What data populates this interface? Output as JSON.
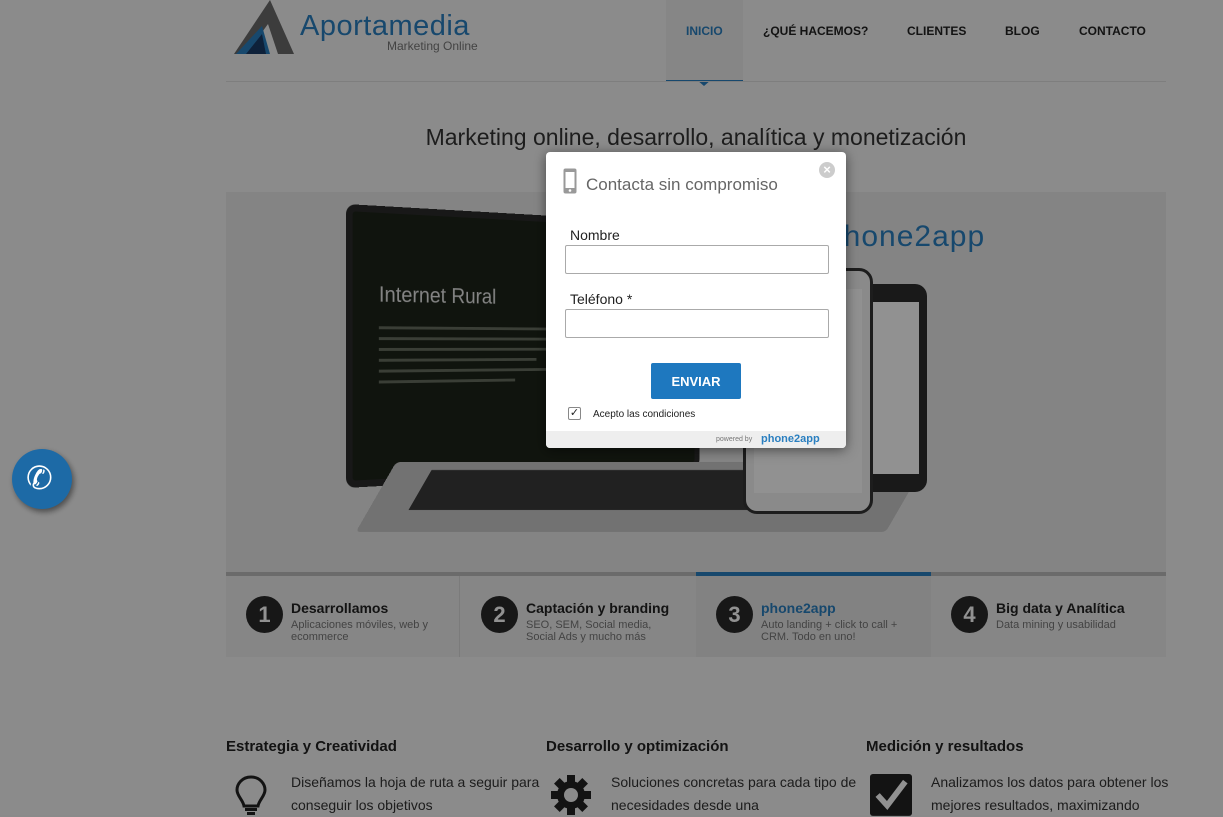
{
  "header": {
    "logo_name": "Aportamedia",
    "logo_tagline": "Marketing Online",
    "nav": [
      "INICIO",
      "¿QUÉ HACEMOS?",
      "CLIENTES",
      "BLOG",
      "CONTACTO"
    ],
    "nav_active": "INICIO"
  },
  "headline": "Marketing online, desarrollo, analítica y monetización",
  "hero": {
    "screen_title": "Internet Rural",
    "brand_text": "phone2app"
  },
  "tabs": [
    {
      "num": "1",
      "title": "Desarrollamos",
      "subtitle": "Aplicaciones móviles, web y ecommerce"
    },
    {
      "num": "2",
      "title": "Captación y branding",
      "subtitle": "SEO, SEM, Social media, Social Ads y mucho más"
    },
    {
      "num": "3",
      "title": "phone2app",
      "subtitle": "Auto landing + click to call + CRM. Todo en uno!"
    },
    {
      "num": "4",
      "title": "Big data y Analítica",
      "subtitle": "Data mining y usabilidad"
    }
  ],
  "active_tab": "3",
  "features": [
    {
      "title": "Estrategia y Creatividad",
      "text": "Diseñamos la hoja de ruta a seguir para conseguir los objetivos",
      "icon": "lightbulb-icon"
    },
    {
      "title": "Desarrollo y optimización",
      "text": "Soluciones concretas para cada tipo de necesidades desde una",
      "icon": "gear-icon"
    },
    {
      "title": "Medición y resultados",
      "text": "Analizamos los datos para obtener los mejores resultados, maximizando",
      "icon": "checkmark-icon"
    }
  ],
  "modal": {
    "title": "Contacta sin compromiso",
    "name_label": "Nombre",
    "name_value": "",
    "phone_label": "Teléfono *",
    "phone_value": "",
    "submit_label": "ENVIAR",
    "terms_label": "Acepto las condiciones",
    "terms_checked": true,
    "powered_by": "powered by",
    "powered_brand": "phone2app"
  },
  "colors": {
    "accent": "#2a7fc0",
    "button": "#1e78bf",
    "call_button": "#1d6aa6"
  }
}
